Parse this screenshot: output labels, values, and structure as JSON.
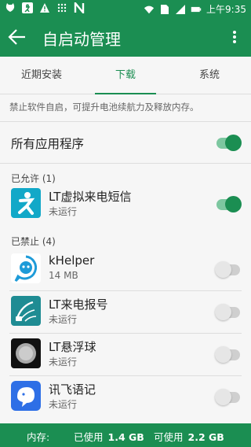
{
  "status_bar": {
    "time": "上午9:35",
    "icons": [
      "cat-icon",
      "runner-icon",
      "warning-icon",
      "dotted-icon",
      "n-logo-icon",
      "wifi-icon",
      "sim-icon",
      "signal-icon",
      "battery-icon"
    ]
  },
  "app_bar": {
    "title": "自启动管理",
    "back_icon": "arrow-left-icon",
    "menu_icon": "more-vertical-icon"
  },
  "tabs": [
    {
      "label": "近期安装",
      "active": false
    },
    {
      "label": "下载",
      "active": true
    },
    {
      "label": "系统",
      "active": false
    }
  ],
  "info_text": "禁止软件自启，可提升电池续航力及释放内存。",
  "all_apps": {
    "label": "所有应用程序",
    "enabled": true
  },
  "allowed_section": {
    "header": "已允许 (1)",
    "apps": [
      {
        "name": "LT虚拟来电短信",
        "status": "未运行",
        "enabled": true,
        "icon": "runner-app-icon",
        "color": "#12a8c8"
      }
    ]
  },
  "blocked_section": {
    "header": "已禁止 (4)",
    "apps": [
      {
        "name": "kHelper",
        "status": "14 MB",
        "enabled": false,
        "icon": "khelper-icon",
        "color": "#1e9bd8"
      },
      {
        "name": "LT来电报号",
        "status": "未运行",
        "enabled": false,
        "icon": "lt-caller-announce-icon",
        "color": "#1f8c93"
      },
      {
        "name": "LT悬浮球",
        "status": "未运行",
        "enabled": false,
        "icon": "lt-float-ball-icon",
        "color": "#111111"
      },
      {
        "name": "讯飞语记",
        "status": "未运行",
        "enabled": false,
        "icon": "xunfei-notes-icon",
        "color": "#2e6fe6"
      }
    ]
  },
  "memory": {
    "label": "内存:",
    "used_label": "已使用",
    "used_value": "1.4 GB",
    "free_label": "可使用",
    "free_value": "2.2 GB"
  },
  "colors": {
    "primary": "#1b8e52",
    "accent_light": "#7dc7a0"
  }
}
